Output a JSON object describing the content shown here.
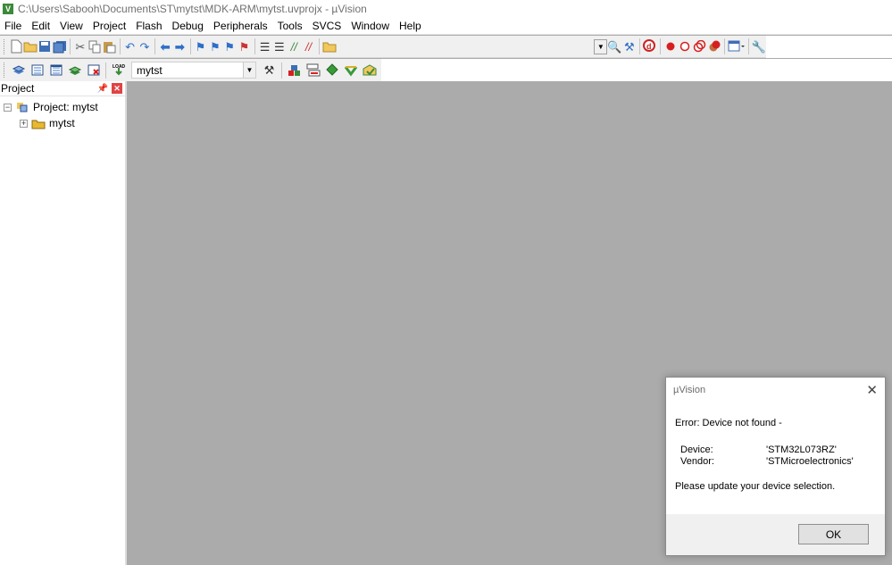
{
  "window": {
    "title": "C:\\Users\\Sabooh\\Documents\\ST\\mytst\\MDK-ARM\\mytst.uvprojx - µVision",
    "app_icon": "uvision-icon"
  },
  "menu": [
    "File",
    "Edit",
    "View",
    "Project",
    "Flash",
    "Debug",
    "Peripherals",
    "Tools",
    "SVCS",
    "Window",
    "Help"
  ],
  "toolbar": {
    "target_name": "mytst",
    "build_icons": [
      "translate-icon",
      "build-icon",
      "rebuild-icon",
      "batch-build-icon",
      "stop-build-icon",
      "download-icon"
    ]
  },
  "project_panel": {
    "title": "Project",
    "root_label": "Project: mytst",
    "child_label": "mytst"
  },
  "dialog": {
    "title": "µVision",
    "close": "✕",
    "error": "Error: Device not found -",
    "device_label": "Device:",
    "device_value": "'STM32L073RZ'",
    "vendor_label": "Vendor:",
    "vendor_value": "'STMicroelectronics'",
    "message": "Please update your device selection.",
    "ok_label": "OK"
  },
  "colors": {
    "workspace": "#ababab",
    "toolbar": "#f0f0f0",
    "breakpoint_red": "#d62020",
    "close_red": "#e04343"
  }
}
